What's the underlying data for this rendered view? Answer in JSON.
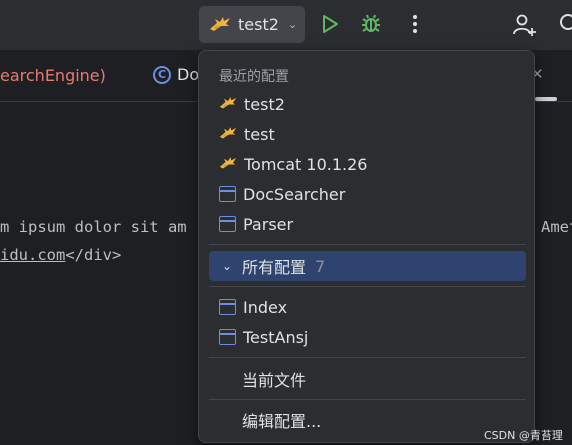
{
  "toolbar": {
    "run_config_label": "test2",
    "run_config_icon": "tomcat-icon",
    "run_icon": "play-icon",
    "debug_icon": "bug-icon",
    "more_icon": "more-vertical-icon",
    "add_user_icon": "add-user-icon",
    "search_icon": "search-icon"
  },
  "tabs": [
    {
      "label": "earchEngine)"
    },
    {
      "label": "Do",
      "icon": "class-icon",
      "icon_glyph": "C"
    }
  ],
  "code": {
    "line1_left": "m ipsum dolor sit am",
    "line1_right": "Amet",
    "line2_link": "idu.com",
    "line2_tag": "</div>"
  },
  "popup": {
    "header": "最近的配置",
    "recent": [
      {
        "label": "test2",
        "icon": "tomcat-icon"
      },
      {
        "label": "test",
        "icon": "tomcat-icon"
      },
      {
        "label": "Tomcat 10.1.26",
        "icon": "tomcat-icon"
      },
      {
        "label": "DocSearcher",
        "icon": "application-icon"
      },
      {
        "label": "Parser",
        "icon": "application-icon"
      }
    ],
    "all_configs": {
      "label": "所有配置",
      "count": "7",
      "icon": "chevron-down-icon"
    },
    "pinned": [
      {
        "label": "Index",
        "icon": "application-icon"
      },
      {
        "label": "TestAnsj",
        "icon": "application-icon"
      }
    ],
    "current_file": "当前文件",
    "edit_configs": "编辑配置..."
  },
  "watermark": "CSDN @青苔理想",
  "colors": {
    "background": "#1e1f22",
    "toolbar": "#2b2d30",
    "popup": "#2b2d30",
    "selected": "#2e436e",
    "accent_blue": "#6d8fe0",
    "run_green": "#5fb865",
    "tab_red": "#e87a6f"
  }
}
